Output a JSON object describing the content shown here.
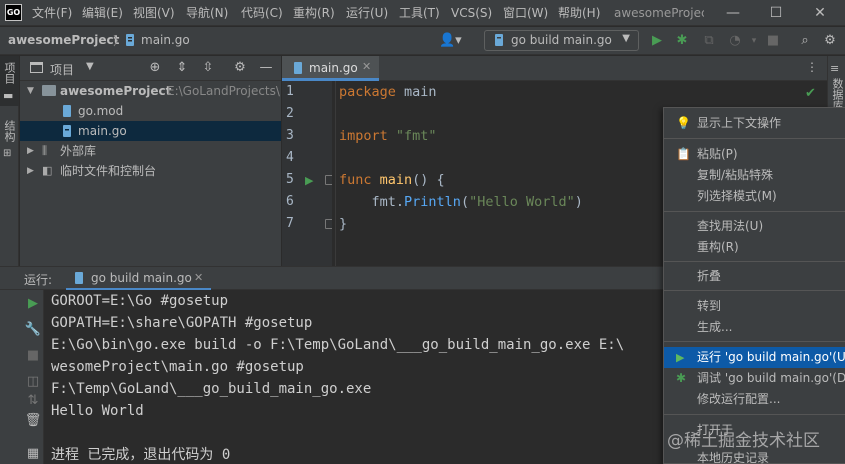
{
  "app": {
    "logo": "GO",
    "window_title": "awesomeProject"
  },
  "menu": [
    "文件(F)",
    "编辑(E)",
    "视图(V)",
    "导航(N)",
    "代码(C)",
    "重构(R)",
    "运行(U)",
    "工具(T)",
    "VCS(S)",
    "窗口(W)",
    "帮助(H)"
  ],
  "window_controls": {
    "minimize": "—",
    "maximize": "☐",
    "close": "✕"
  },
  "navbar": {
    "project": "awesomeProject",
    "separator": "〉",
    "file": "main.go",
    "run_config": "go build main.go"
  },
  "left_strip": {
    "project_tab": "项目",
    "structure_tab": "结构"
  },
  "right_strip": {
    "database_tab": "数据库"
  },
  "project_panel": {
    "title": "项目",
    "tree": [
      {
        "label": "awesomeProject",
        "hint": "E:\\GoLandProjects\\"
      },
      {
        "label": "go.mod"
      },
      {
        "label": "main.go"
      },
      {
        "label": "外部库"
      },
      {
        "label": "临时文件和控制台"
      }
    ]
  },
  "editor": {
    "tab_label": "main.go",
    "line_numbers": [
      "1",
      "2",
      "3",
      "4",
      "5",
      "6",
      "7"
    ],
    "code": {
      "l1_kw": "package",
      "l1_rest": " main",
      "l3_kw": "import",
      "l3_str": "\"fmt\"",
      "l5_kw": "func",
      "l5_fn": "main",
      "l5_rest": "() {",
      "l6_pkg": "    fmt.",
      "l6_call": "Println",
      "l6_open": "(",
      "l6_str": "\"Hello World\"",
      "l6_close": ")",
      "l7": "}"
    }
  },
  "run_panel": {
    "label": "运行:",
    "tab": "go build main.go",
    "console": [
      "GOROOT=E:\\Go #gosetup",
      "GOPATH=E:\\share\\GOPATH #gosetup",
      "E:\\Go\\bin\\go.exe build -o F:\\Temp\\GoLand\\___go_build_main_go.exe E:\\",
      "wesomeProject\\main.go #gosetup",
      "F:\\Temp\\GoLand\\___go_build_main_go.exe",
      "Hello World",
      "",
      "进程 已完成，退出代码为 0"
    ]
  },
  "context_menu": {
    "show_context_actions": "显示上下文操作",
    "paste": "粘贴(P)",
    "copy_paste_special": "复制/粘贴特殊",
    "column_selection": "列选择模式(M)",
    "find_usages": "查找用法(U)",
    "refactor": "重构(R)",
    "folding": "折叠",
    "goto": "转到",
    "generate": "生成...",
    "run": "运行 'go build main.go'(U)",
    "debug": "调试 'go build main.go'(D)",
    "modify_run_config": "修改运行配置...",
    "open_in": "打开于",
    "local_history": "本地历史记录"
  },
  "watermark": "@稀土掘金技术社区",
  "colors": {
    "accent": "#4a88c7",
    "selection": "#0d5aa7",
    "run_green": "#499c54",
    "keyword": "#cc7832"
  }
}
